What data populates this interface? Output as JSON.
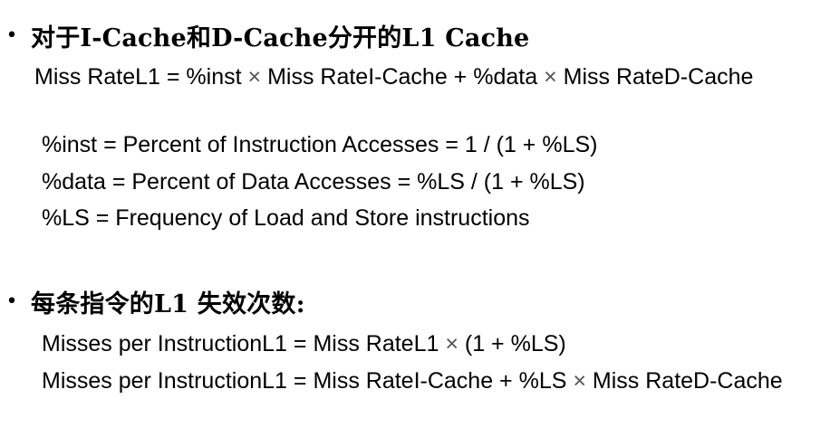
{
  "section1": {
    "bullet": "•",
    "heading": "对于I-Cache和D-Cache分开的L1 Cache",
    "lines": [
      {
        "parts": [
          "Miss RateL1 = %inst ",
          "×",
          " Miss RateI-Cache + %data ",
          "×",
          " Miss RateD-Cache"
        ]
      },
      {
        "text": "%inst = Percent of Instruction Accesses = 1 / (1 + %LS)"
      },
      {
        "text": "%data = Percent of Data Accesses = %LS / (1 + %LS)"
      },
      {
        "text": "%LS = Frequency of Load and Store instructions"
      }
    ]
  },
  "section2": {
    "bullet": "•",
    "heading": "每条指令的L1 失效次数:",
    "lines": [
      {
        "parts": [
          "Misses per InstructionL1 = Miss RateL1 ",
          "×",
          " (1 + %LS)"
        ]
      },
      {
        "parts": [
          "Misses per InstructionL1 = Miss RateI-Cache + %LS ",
          "×",
          " Miss RateD-Cache"
        ]
      }
    ]
  }
}
